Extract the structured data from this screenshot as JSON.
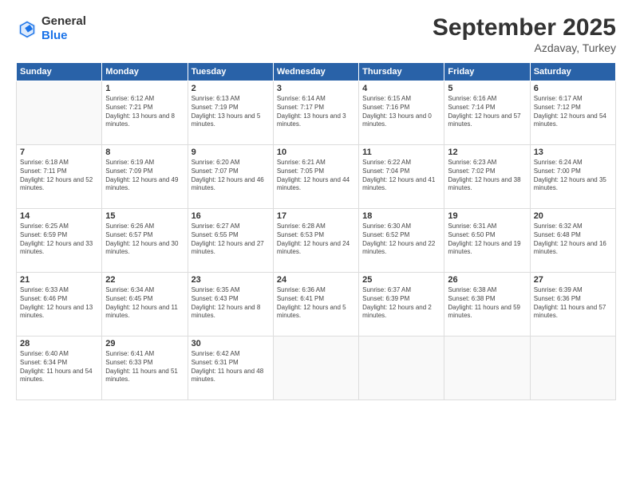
{
  "logo": {
    "general": "General",
    "blue": "Blue"
  },
  "header": {
    "title": "September 2025",
    "location": "Azdavay, Turkey"
  },
  "days": [
    "Sunday",
    "Monday",
    "Tuesday",
    "Wednesday",
    "Thursday",
    "Friday",
    "Saturday"
  ],
  "weeks": [
    [
      {
        "day": "",
        "sunrise": "",
        "sunset": "",
        "daylight": ""
      },
      {
        "day": "1",
        "sunrise": "Sunrise: 6:12 AM",
        "sunset": "Sunset: 7:21 PM",
        "daylight": "Daylight: 13 hours and 8 minutes."
      },
      {
        "day": "2",
        "sunrise": "Sunrise: 6:13 AM",
        "sunset": "Sunset: 7:19 PM",
        "daylight": "Daylight: 13 hours and 5 minutes."
      },
      {
        "day": "3",
        "sunrise": "Sunrise: 6:14 AM",
        "sunset": "Sunset: 7:17 PM",
        "daylight": "Daylight: 13 hours and 3 minutes."
      },
      {
        "day": "4",
        "sunrise": "Sunrise: 6:15 AM",
        "sunset": "Sunset: 7:16 PM",
        "daylight": "Daylight: 13 hours and 0 minutes."
      },
      {
        "day": "5",
        "sunrise": "Sunrise: 6:16 AM",
        "sunset": "Sunset: 7:14 PM",
        "daylight": "Daylight: 12 hours and 57 minutes."
      },
      {
        "day": "6",
        "sunrise": "Sunrise: 6:17 AM",
        "sunset": "Sunset: 7:12 PM",
        "daylight": "Daylight: 12 hours and 54 minutes."
      }
    ],
    [
      {
        "day": "7",
        "sunrise": "Sunrise: 6:18 AM",
        "sunset": "Sunset: 7:11 PM",
        "daylight": "Daylight: 12 hours and 52 minutes."
      },
      {
        "day": "8",
        "sunrise": "Sunrise: 6:19 AM",
        "sunset": "Sunset: 7:09 PM",
        "daylight": "Daylight: 12 hours and 49 minutes."
      },
      {
        "day": "9",
        "sunrise": "Sunrise: 6:20 AM",
        "sunset": "Sunset: 7:07 PM",
        "daylight": "Daylight: 12 hours and 46 minutes."
      },
      {
        "day": "10",
        "sunrise": "Sunrise: 6:21 AM",
        "sunset": "Sunset: 7:05 PM",
        "daylight": "Daylight: 12 hours and 44 minutes."
      },
      {
        "day": "11",
        "sunrise": "Sunrise: 6:22 AM",
        "sunset": "Sunset: 7:04 PM",
        "daylight": "Daylight: 12 hours and 41 minutes."
      },
      {
        "day": "12",
        "sunrise": "Sunrise: 6:23 AM",
        "sunset": "Sunset: 7:02 PM",
        "daylight": "Daylight: 12 hours and 38 minutes."
      },
      {
        "day": "13",
        "sunrise": "Sunrise: 6:24 AM",
        "sunset": "Sunset: 7:00 PM",
        "daylight": "Daylight: 12 hours and 35 minutes."
      }
    ],
    [
      {
        "day": "14",
        "sunrise": "Sunrise: 6:25 AM",
        "sunset": "Sunset: 6:59 PM",
        "daylight": "Daylight: 12 hours and 33 minutes."
      },
      {
        "day": "15",
        "sunrise": "Sunrise: 6:26 AM",
        "sunset": "Sunset: 6:57 PM",
        "daylight": "Daylight: 12 hours and 30 minutes."
      },
      {
        "day": "16",
        "sunrise": "Sunrise: 6:27 AM",
        "sunset": "Sunset: 6:55 PM",
        "daylight": "Daylight: 12 hours and 27 minutes."
      },
      {
        "day": "17",
        "sunrise": "Sunrise: 6:28 AM",
        "sunset": "Sunset: 6:53 PM",
        "daylight": "Daylight: 12 hours and 24 minutes."
      },
      {
        "day": "18",
        "sunrise": "Sunrise: 6:30 AM",
        "sunset": "Sunset: 6:52 PM",
        "daylight": "Daylight: 12 hours and 22 minutes."
      },
      {
        "day": "19",
        "sunrise": "Sunrise: 6:31 AM",
        "sunset": "Sunset: 6:50 PM",
        "daylight": "Daylight: 12 hours and 19 minutes."
      },
      {
        "day": "20",
        "sunrise": "Sunrise: 6:32 AM",
        "sunset": "Sunset: 6:48 PM",
        "daylight": "Daylight: 12 hours and 16 minutes."
      }
    ],
    [
      {
        "day": "21",
        "sunrise": "Sunrise: 6:33 AM",
        "sunset": "Sunset: 6:46 PM",
        "daylight": "Daylight: 12 hours and 13 minutes."
      },
      {
        "day": "22",
        "sunrise": "Sunrise: 6:34 AM",
        "sunset": "Sunset: 6:45 PM",
        "daylight": "Daylight: 12 hours and 11 minutes."
      },
      {
        "day": "23",
        "sunrise": "Sunrise: 6:35 AM",
        "sunset": "Sunset: 6:43 PM",
        "daylight": "Daylight: 12 hours and 8 minutes."
      },
      {
        "day": "24",
        "sunrise": "Sunrise: 6:36 AM",
        "sunset": "Sunset: 6:41 PM",
        "daylight": "Daylight: 12 hours and 5 minutes."
      },
      {
        "day": "25",
        "sunrise": "Sunrise: 6:37 AM",
        "sunset": "Sunset: 6:39 PM",
        "daylight": "Daylight: 12 hours and 2 minutes."
      },
      {
        "day": "26",
        "sunrise": "Sunrise: 6:38 AM",
        "sunset": "Sunset: 6:38 PM",
        "daylight": "Daylight: 11 hours and 59 minutes."
      },
      {
        "day": "27",
        "sunrise": "Sunrise: 6:39 AM",
        "sunset": "Sunset: 6:36 PM",
        "daylight": "Daylight: 11 hours and 57 minutes."
      }
    ],
    [
      {
        "day": "28",
        "sunrise": "Sunrise: 6:40 AM",
        "sunset": "Sunset: 6:34 PM",
        "daylight": "Daylight: 11 hours and 54 minutes."
      },
      {
        "day": "29",
        "sunrise": "Sunrise: 6:41 AM",
        "sunset": "Sunset: 6:33 PM",
        "daylight": "Daylight: 11 hours and 51 minutes."
      },
      {
        "day": "30",
        "sunrise": "Sunrise: 6:42 AM",
        "sunset": "Sunset: 6:31 PM",
        "daylight": "Daylight: 11 hours and 48 minutes."
      },
      {
        "day": "",
        "sunrise": "",
        "sunset": "",
        "daylight": ""
      },
      {
        "day": "",
        "sunrise": "",
        "sunset": "",
        "daylight": ""
      },
      {
        "day": "",
        "sunrise": "",
        "sunset": "",
        "daylight": ""
      },
      {
        "day": "",
        "sunrise": "",
        "sunset": "",
        "daylight": ""
      }
    ]
  ]
}
